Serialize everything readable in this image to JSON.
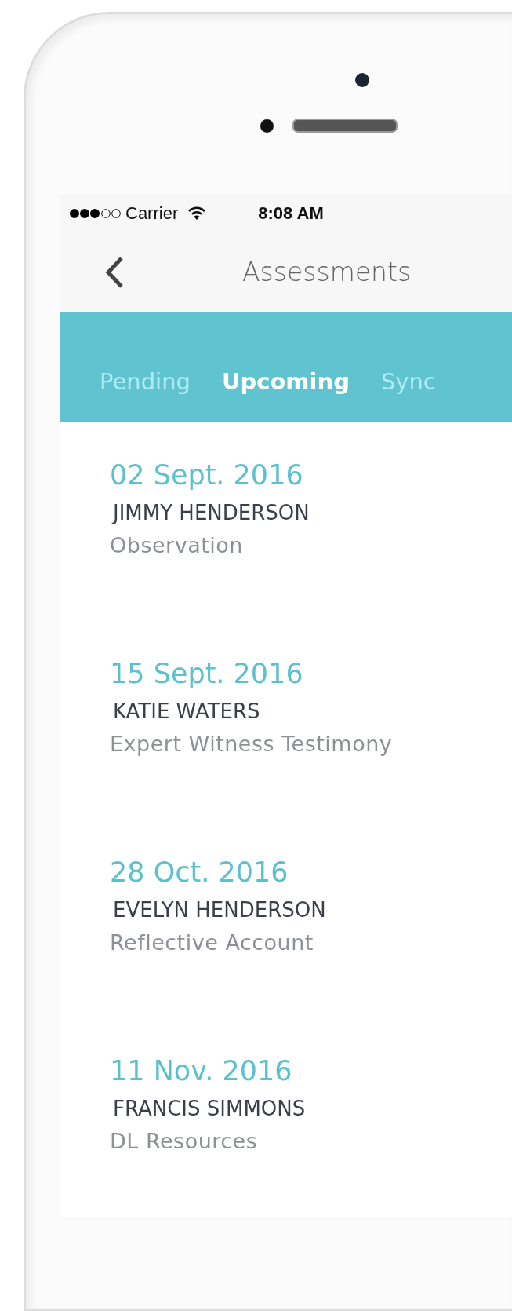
{
  "status_bar": {
    "carrier": "Carrier",
    "time": "8:08 AM"
  },
  "nav": {
    "title": "Assessments"
  },
  "tabs": [
    {
      "label": "Pending",
      "selected": false
    },
    {
      "label": "Upcoming",
      "selected": true
    },
    {
      "label": "Sync",
      "selected": false
    }
  ],
  "assessments": [
    {
      "date": "02 Sept. 2016",
      "name": "JIMMY HENDERSON",
      "type": "Observation"
    },
    {
      "date": "15 Sept. 2016",
      "name": "KATIE WATERS",
      "type": "Expert Witness Testimony"
    },
    {
      "date": "28 Oct. 2016",
      "name": "EVELYN HENDERSON",
      "type": "Reflective Account"
    },
    {
      "date": "11 Nov. 2016",
      "name": "FRANCIS SIMMONS",
      "type": "DL Resources"
    }
  ]
}
